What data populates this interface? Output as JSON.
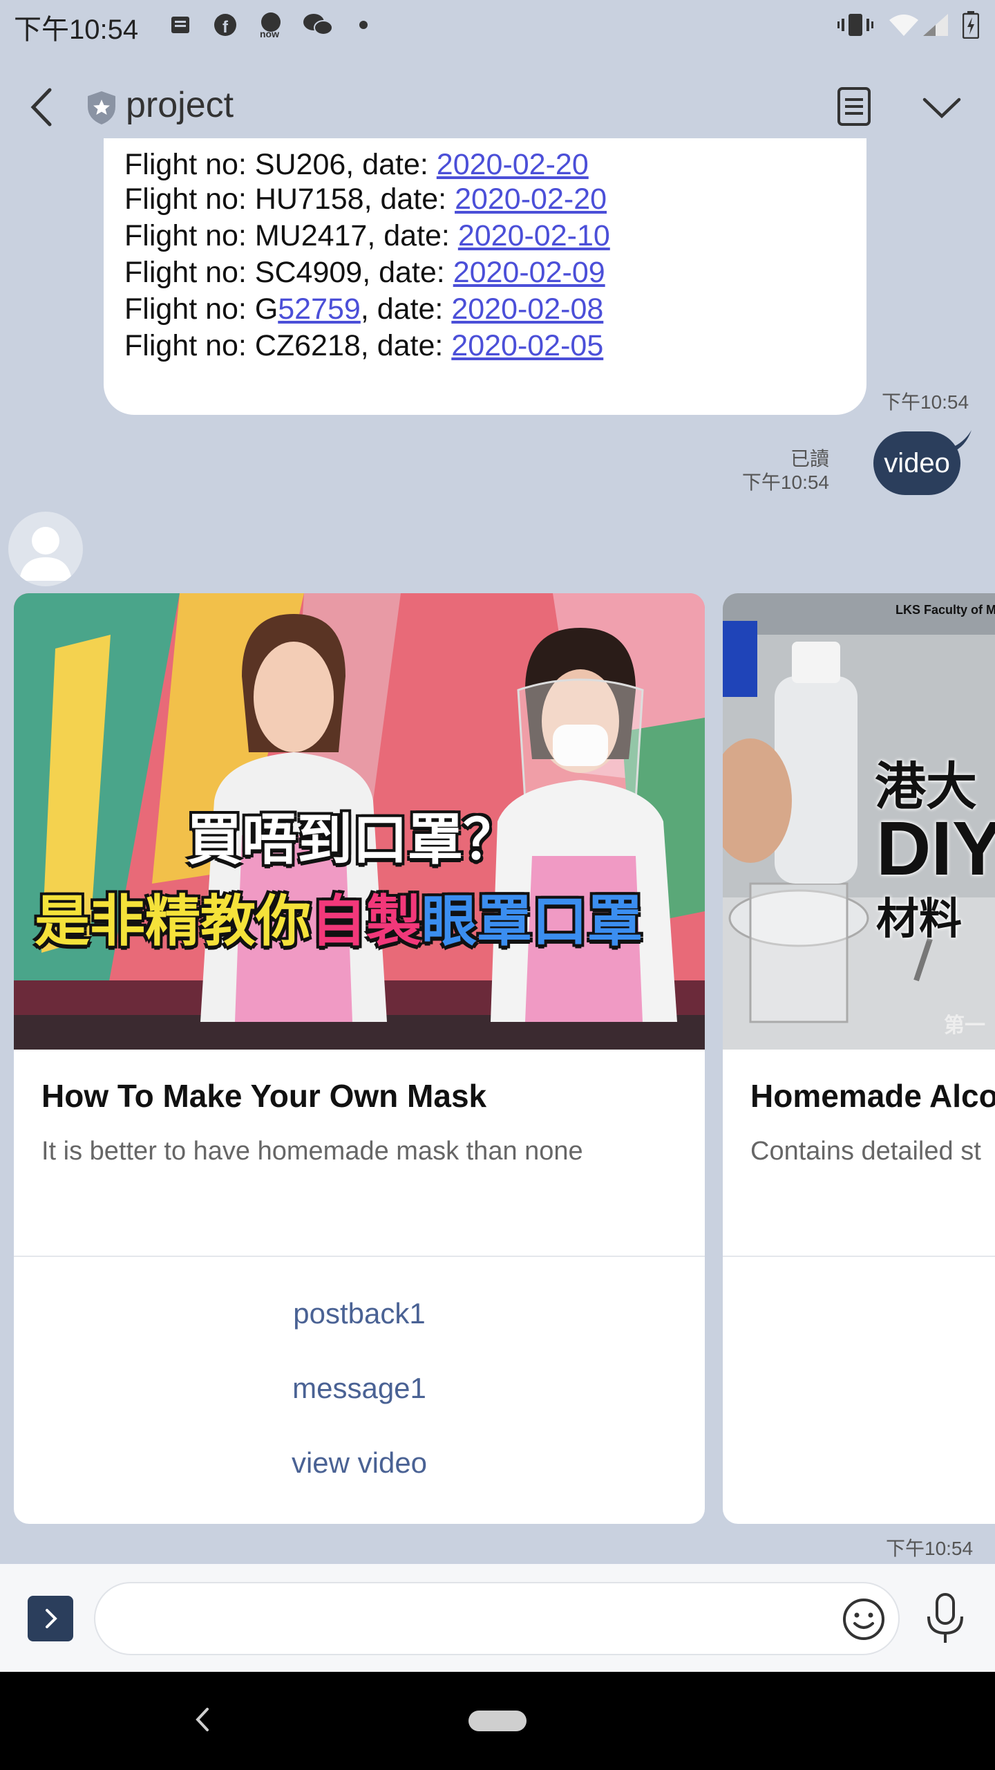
{
  "status_bar": {
    "time": "下午10:54",
    "icons": [
      "notification-icon",
      "facebook-icon",
      "now-icon",
      "wechat-icon",
      "dot-icon",
      "vibrate-icon",
      "wifi-icon",
      "signal-icon",
      "battery-icon"
    ]
  },
  "header": {
    "title": "project",
    "back_icon": "back-chevron-icon",
    "notes_icon": "notes-icon",
    "dropdown_icon": "chevron-down-icon"
  },
  "flight_message": {
    "lines": [
      {
        "prefix": "Flight no: SU206, date: ",
        "date": "2020-02-20"
      },
      {
        "prefix": "Flight no: HU7158, date: ",
        "date": "2020-02-20"
      },
      {
        "prefix": "Flight no: MU2417, date: ",
        "date": "2020-02-10"
      },
      {
        "prefix": "Flight no: SC4909, date: ",
        "date": "2020-02-09"
      },
      {
        "prefix": "Flight no: G",
        "link_part": "52759",
        "mid": ", date: ",
        "date": "2020-02-08"
      },
      {
        "prefix": "Flight no: CZ6218, date: ",
        "date": "2020-02-05"
      }
    ],
    "time": "下午10:54"
  },
  "user_message": {
    "text": "video",
    "read_label": "已讀",
    "time": "下午10:54"
  },
  "carousel": {
    "cards": [
      {
        "title": "How To Make Your Own Mask",
        "description": "It is better to have homemade mask than none",
        "thumb_line1": "買唔到口罩？",
        "thumb_line2a": "是非精教你",
        "thumb_line2b": "自製",
        "thumb_line2c": "眼罩口罩",
        "actions": [
          "postback1",
          "message1",
          "view video"
        ]
      },
      {
        "title": "Homemade Alco",
        "description": "Contains detailed st",
        "thumb_top": "LKS Faculty of Medicine",
        "thumb_line1": "港大",
        "thumb_line2": "DIY",
        "thumb_line3": "材料",
        "thumb_corner": "第一"
      }
    ],
    "time": "下午10:54"
  },
  "input_bar": {
    "placeholder": "",
    "emoji_icon": "emoji-icon",
    "mic_icon": "microphone-icon"
  }
}
